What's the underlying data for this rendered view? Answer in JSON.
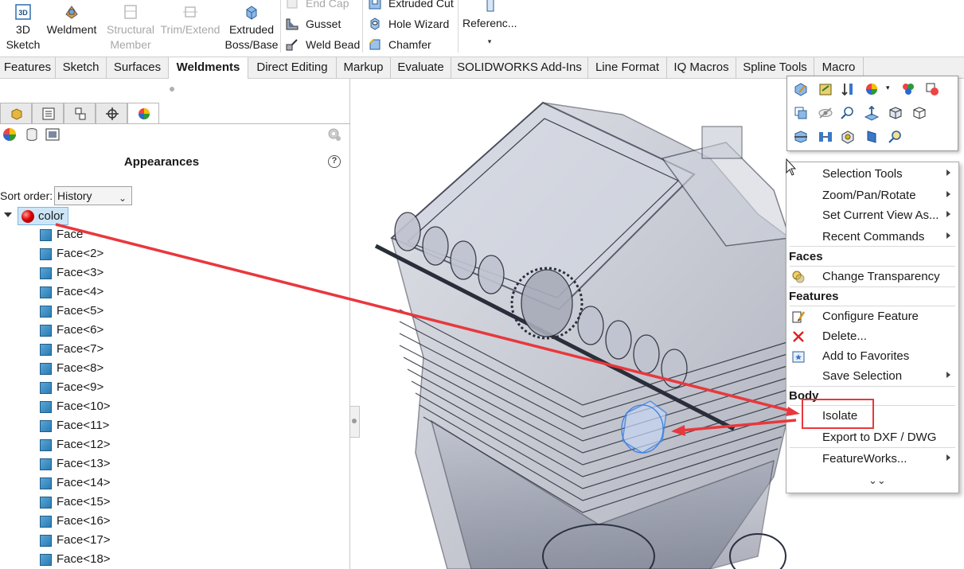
{
  "ribbon": {
    "buttons": [
      {
        "label1": "3D",
        "label2": "Sketch",
        "disabled": false,
        "icon": "3d-sketch-icon"
      },
      {
        "label1": "Weldment",
        "label2": "",
        "disabled": false,
        "icon": "weldment-icon"
      },
      {
        "label1": "Structural",
        "label2": "Member",
        "disabled": true,
        "icon": "structural-member-icon"
      },
      {
        "label1": "Trim/Extend",
        "label2": "",
        "disabled": true,
        "icon": "trim-extend-icon"
      },
      {
        "label1": "Extruded",
        "label2": "Boss/Base",
        "disabled": false,
        "icon": "extruded-boss-icon"
      }
    ],
    "stack1": [
      {
        "label": "End Cap",
        "disabled": true,
        "icon": "end-cap-icon"
      },
      {
        "label": "Gusset",
        "disabled": false,
        "icon": "gusset-icon"
      },
      {
        "label": "Weld Bead",
        "disabled": false,
        "icon": "weld-bead-icon"
      }
    ],
    "stack2": [
      {
        "label": "Extruded Cut",
        "disabled": false,
        "icon": "extruded-cut-icon"
      },
      {
        "label": "Hole Wizard",
        "disabled": false,
        "icon": "hole-wizard-icon"
      },
      {
        "label": "Chamfer",
        "disabled": false,
        "icon": "chamfer-icon"
      }
    ],
    "reference": {
      "label": "Referenc...",
      "icon": "reference-geometry-icon"
    }
  },
  "tabs": [
    "Features",
    "Sketch",
    "Surfaces",
    "Weldments",
    "Direct Editing",
    "Markup",
    "Evaluate",
    "SOLIDWORKS Add-Ins",
    "Line Format",
    "IQ Macros",
    "Spline Tools",
    "Macro"
  ],
  "active_tab": "Weldments",
  "panel": {
    "title": "Appearances",
    "help": "?",
    "sort_label": "Sort order:",
    "sort_value": "History",
    "root_label": "color",
    "faces": [
      "Face",
      "Face<2>",
      "Face<3>",
      "Face<4>",
      "Face<5>",
      "Face<6>",
      "Face<7>",
      "Face<8>",
      "Face<9>",
      "Face<10>",
      "Face<11>",
      "Face<12>",
      "Face<13>",
      "Face<14>",
      "Face<15>",
      "Face<16>",
      "Face<17>",
      "Face<18>"
    ]
  },
  "context_menu": {
    "items_top": [
      {
        "label": "Selection Tools",
        "submenu": true
      },
      {
        "label": "Zoom/Pan/Rotate",
        "submenu": true
      },
      {
        "label": "Set Current View As...",
        "submenu": true
      },
      {
        "label": "Recent Commands",
        "submenu": true
      }
    ],
    "faces_header": "Faces",
    "faces_items": [
      {
        "label": "Change Transparency",
        "icon": "transparency-icon"
      }
    ],
    "features_header": "Features",
    "features_items": [
      {
        "label": "Configure Feature",
        "icon": "configure-feature-icon"
      },
      {
        "label": "Delete...",
        "icon": "delete-icon"
      },
      {
        "label": "Add to Favorites",
        "icon": "favorites-icon"
      },
      {
        "label": "Save Selection",
        "submenu": true
      }
    ],
    "body_header": "Body",
    "body_items": [
      {
        "label": "Isolate"
      },
      {
        "label": "Export to DXF / DWG"
      },
      {
        "label": "FeatureWorks...",
        "submenu": true
      }
    ],
    "more": "⌄⌄"
  },
  "colors": {
    "accent_red": "#e8383d",
    "selection_blue": "#cde6f7",
    "face_blue": "#2a7cb4"
  }
}
